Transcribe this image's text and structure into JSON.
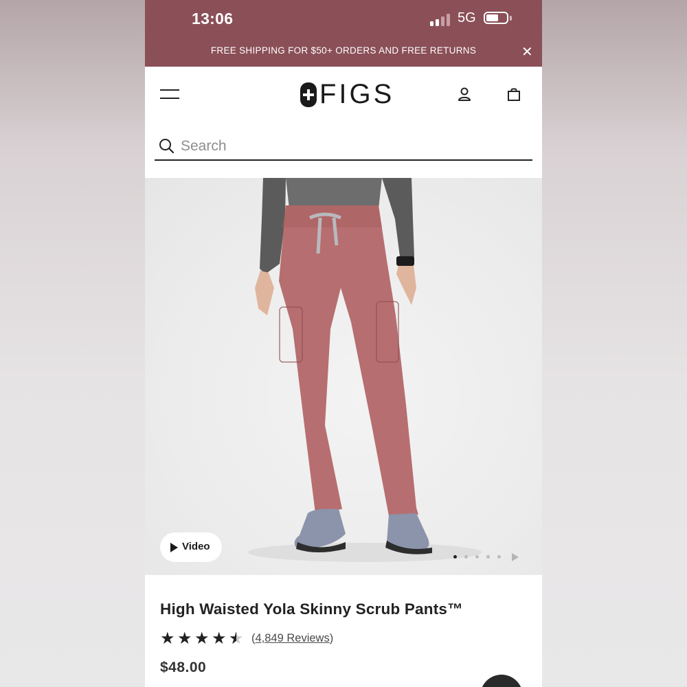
{
  "status_bar": {
    "time": "13:06",
    "network": "5G",
    "signal_bars_active": 2,
    "signal_bars_total": 4,
    "battery_level": 0.6
  },
  "promo_banner": {
    "text": "FREE SHIPPING FOR $50+ ORDERS AND FREE RETURNS",
    "close_icon": "close-icon",
    "background": "#8a4f57"
  },
  "header": {
    "logo_text": "FIGS",
    "icons": [
      "menu-icon",
      "account-icon",
      "shopping-bag-icon"
    ]
  },
  "search": {
    "placeholder": "Search",
    "value": "",
    "icon": "search-icon"
  },
  "gallery": {
    "video_label": "Video",
    "slide_count": 5,
    "active_slide": 1,
    "product_color": "#b76e70"
  },
  "product": {
    "title": "High Waisted Yola Skinny Scrub Pants™",
    "rating": 4.5,
    "review_count_text": "4,849 Reviews",
    "review_prefix": "(",
    "review_suffix": ")",
    "price": "$48.00"
  },
  "colors": {
    "brand_band": "#8a4f57",
    "text_dark": "#222222"
  }
}
